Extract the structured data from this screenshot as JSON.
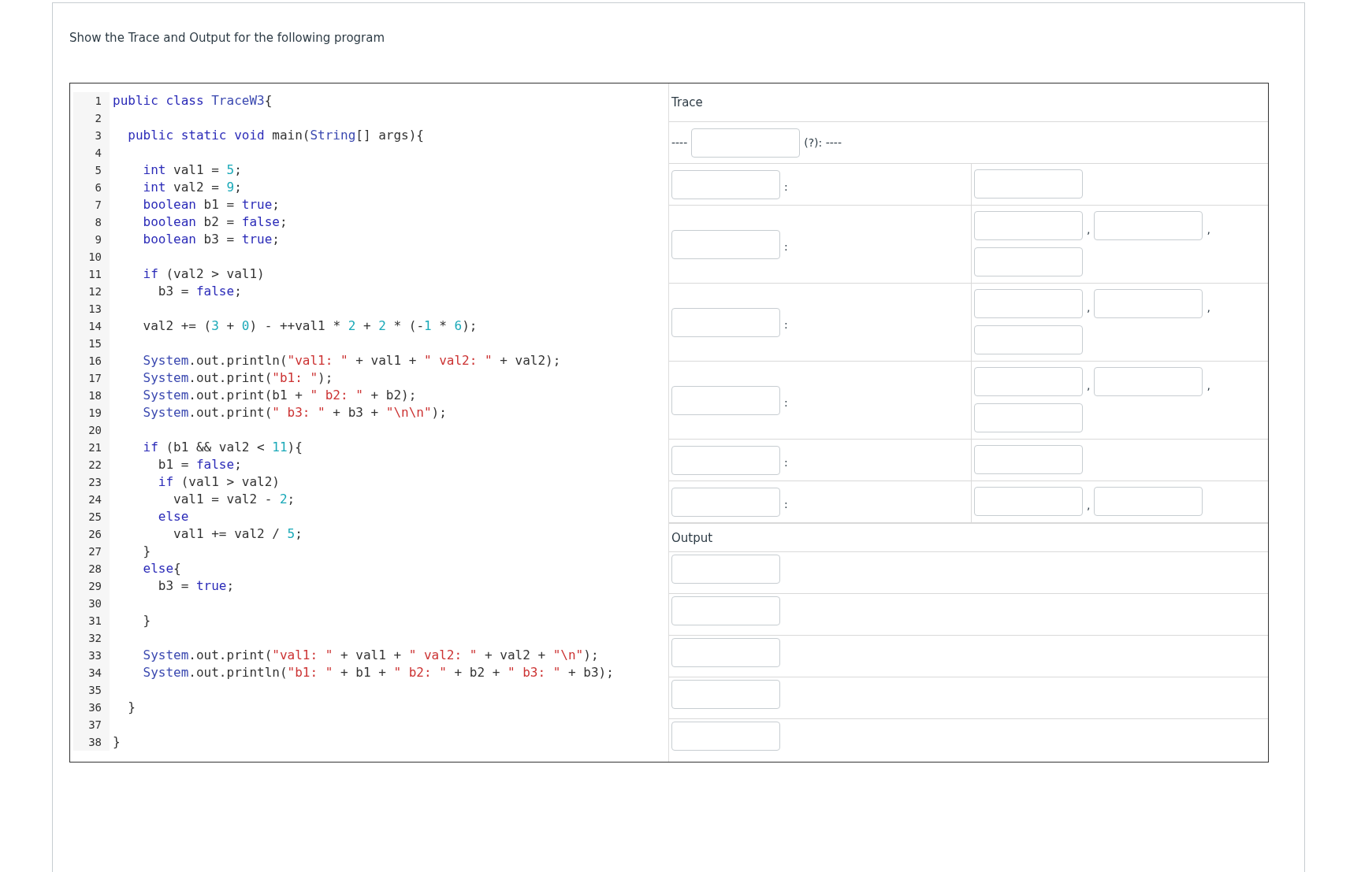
{
  "prompt": "Show the Trace and Output for the following program",
  "code": [
    {
      "n": "1",
      "tokens": [
        {
          "kind": "kw",
          "t": "public class "
        },
        {
          "kind": "type",
          "t": "TraceW3"
        },
        {
          "kind": "plain",
          "t": "{"
        }
      ]
    },
    {
      "n": "2"
    },
    {
      "n": "3",
      "tokens": [
        {
          "kind": "kw",
          "t": "  public static void "
        },
        {
          "kind": "plain",
          "t": "main("
        },
        {
          "kind": "type",
          "t": "String"
        },
        {
          "kind": "plain",
          "t": "[] args){"
        }
      ]
    },
    {
      "n": "4"
    },
    {
      "n": "5",
      "tokens": [
        {
          "kind": "kw",
          "t": "    int"
        },
        {
          "kind": "plain",
          "t": " val1 = "
        },
        {
          "kind": "num",
          "t": "5"
        },
        {
          "kind": "plain",
          "t": ";"
        }
      ]
    },
    {
      "n": "6",
      "tokens": [
        {
          "kind": "kw",
          "t": "    int"
        },
        {
          "kind": "plain",
          "t": " val2 = "
        },
        {
          "kind": "num",
          "t": "9"
        },
        {
          "kind": "plain",
          "t": ";"
        }
      ]
    },
    {
      "n": "7",
      "tokens": [
        {
          "kind": "kw",
          "t": "    boolean"
        },
        {
          "kind": "plain",
          "t": " b1 = "
        },
        {
          "kind": "kw",
          "t": "true"
        },
        {
          "kind": "plain",
          "t": ";"
        }
      ]
    },
    {
      "n": "8",
      "tokens": [
        {
          "kind": "kw",
          "t": "    boolean"
        },
        {
          "kind": "plain",
          "t": " b2 = "
        },
        {
          "kind": "kw",
          "t": "false"
        },
        {
          "kind": "plain",
          "t": ";"
        }
      ]
    },
    {
      "n": "9",
      "tokens": [
        {
          "kind": "kw",
          "t": "    boolean"
        },
        {
          "kind": "plain",
          "t": " b3 = "
        },
        {
          "kind": "kw",
          "t": "true"
        },
        {
          "kind": "plain",
          "t": ";"
        }
      ]
    },
    {
      "n": "10"
    },
    {
      "n": "11",
      "tokens": [
        {
          "kind": "kw",
          "t": "    if"
        },
        {
          "kind": "plain",
          "t": " (val2 > val1)"
        }
      ]
    },
    {
      "n": "12",
      "tokens": [
        {
          "kind": "plain",
          "t": "      b3 = "
        },
        {
          "kind": "kw",
          "t": "false"
        },
        {
          "kind": "plain",
          "t": ";"
        }
      ]
    },
    {
      "n": "13"
    },
    {
      "n": "14",
      "tokens": [
        {
          "kind": "plain",
          "t": "    val2 += ("
        },
        {
          "kind": "num",
          "t": "3"
        },
        {
          "kind": "plain",
          "t": " + "
        },
        {
          "kind": "num",
          "t": "0"
        },
        {
          "kind": "plain",
          "t": ") - ++val1 * "
        },
        {
          "kind": "num",
          "t": "2"
        },
        {
          "kind": "plain",
          "t": " + "
        },
        {
          "kind": "num",
          "t": "2"
        },
        {
          "kind": "plain",
          "t": " * (-"
        },
        {
          "kind": "num",
          "t": "1"
        },
        {
          "kind": "plain",
          "t": " * "
        },
        {
          "kind": "num",
          "t": "6"
        },
        {
          "kind": "plain",
          "t": ");"
        }
      ]
    },
    {
      "n": "15"
    },
    {
      "n": "16",
      "tokens": [
        {
          "kind": "type",
          "t": "    System"
        },
        {
          "kind": "plain",
          "t": ".out.println("
        },
        {
          "kind": "str",
          "t": "\"val1: \""
        },
        {
          "kind": "plain",
          "t": " + val1 + "
        },
        {
          "kind": "str",
          "t": "\" val2: \""
        },
        {
          "kind": "plain",
          "t": " + val2);"
        }
      ]
    },
    {
      "n": "17",
      "tokens": [
        {
          "kind": "type",
          "t": "    System"
        },
        {
          "kind": "plain",
          "t": ".out.print("
        },
        {
          "kind": "str",
          "t": "\"b1: \""
        },
        {
          "kind": "plain",
          "t": ");"
        }
      ]
    },
    {
      "n": "18",
      "tokens": [
        {
          "kind": "type",
          "t": "    System"
        },
        {
          "kind": "plain",
          "t": ".out.print(b1 + "
        },
        {
          "kind": "str",
          "t": "\" b2: \""
        },
        {
          "kind": "plain",
          "t": " + b2);"
        }
      ]
    },
    {
      "n": "19",
      "tokens": [
        {
          "kind": "type",
          "t": "    System"
        },
        {
          "kind": "plain",
          "t": ".out.print("
        },
        {
          "kind": "str",
          "t": "\" b3: \""
        },
        {
          "kind": "plain",
          "t": " + b3 + "
        },
        {
          "kind": "str",
          "t": "\"\\n\\n\""
        },
        {
          "kind": "plain",
          "t": ");"
        }
      ]
    },
    {
      "n": "20"
    },
    {
      "n": "21",
      "tokens": [
        {
          "kind": "kw",
          "t": "    if"
        },
        {
          "kind": "plain",
          "t": " (b1 && val2 < "
        },
        {
          "kind": "num",
          "t": "11"
        },
        {
          "kind": "plain",
          "t": "){"
        }
      ]
    },
    {
      "n": "22",
      "tokens": [
        {
          "kind": "plain",
          "t": "      b1 = "
        },
        {
          "kind": "kw",
          "t": "false"
        },
        {
          "kind": "plain",
          "t": ";"
        }
      ]
    },
    {
      "n": "23",
      "tokens": [
        {
          "kind": "kw",
          "t": "      if"
        },
        {
          "kind": "plain",
          "t": " (val1 > val2)"
        }
      ]
    },
    {
      "n": "24",
      "tokens": [
        {
          "kind": "plain",
          "t": "        val1 = val2 - "
        },
        {
          "kind": "num",
          "t": "2"
        },
        {
          "kind": "plain",
          "t": ";"
        }
      ]
    },
    {
      "n": "25",
      "tokens": [
        {
          "kind": "kw",
          "t": "      else"
        }
      ]
    },
    {
      "n": "26",
      "tokens": [
        {
          "kind": "plain",
          "t": "        val1 += val2 / "
        },
        {
          "kind": "num",
          "t": "5"
        },
        {
          "kind": "plain",
          "t": ";"
        }
      ]
    },
    {
      "n": "27",
      "tokens": [
        {
          "kind": "plain",
          "t": "    }"
        }
      ]
    },
    {
      "n": "28",
      "tokens": [
        {
          "kind": "kw",
          "t": "    else"
        },
        {
          "kind": "plain",
          "t": "{"
        }
      ]
    },
    {
      "n": "29",
      "tokens": [
        {
          "kind": "plain",
          "t": "      b3 = "
        },
        {
          "kind": "kw",
          "t": "true"
        },
        {
          "kind": "plain",
          "t": ";"
        }
      ]
    },
    {
      "n": "30"
    },
    {
      "n": "31",
      "tokens": [
        {
          "kind": "plain",
          "t": "    }"
        }
      ]
    },
    {
      "n": "32"
    },
    {
      "n": "33",
      "tokens": [
        {
          "kind": "type",
          "t": "    System"
        },
        {
          "kind": "plain",
          "t": ".out.print("
        },
        {
          "kind": "str",
          "t": "\"val1: \""
        },
        {
          "kind": "plain",
          "t": " + val1 + "
        },
        {
          "kind": "str",
          "t": "\" val2: \""
        },
        {
          "kind": "plain",
          "t": " + val2 + "
        },
        {
          "kind": "str",
          "t": "\"\\n\""
        },
        {
          "kind": "plain",
          "t": ");"
        }
      ]
    },
    {
      "n": "34",
      "tokens": [
        {
          "kind": "type",
          "t": "    System"
        },
        {
          "kind": "plain",
          "t": ".out.println("
        },
        {
          "kind": "str",
          "t": "\"b1: \""
        },
        {
          "kind": "plain",
          "t": " + b1 + "
        },
        {
          "kind": "str",
          "t": "\" b2: \""
        },
        {
          "kind": "plain",
          "t": " + b2 + "
        },
        {
          "kind": "str",
          "t": "\" b3: \""
        },
        {
          "kind": "plain",
          "t": " + b3);"
        }
      ]
    },
    {
      "n": "35"
    },
    {
      "n": "36",
      "tokens": [
        {
          "kind": "plain",
          "t": "  }"
        }
      ]
    },
    {
      "n": "37"
    },
    {
      "n": "38",
      "tokens": [
        {
          "kind": "plain",
          "t": "}"
        }
      ]
    }
  ],
  "trace": {
    "heading": "Trace",
    "first_row": {
      "before": "----",
      "after": "(?): ----"
    },
    "rows": [
      {
        "separator": ":",
        "right_lines": [
          [
            {
              "kind": "field"
            }
          ]
        ]
      },
      {
        "separator": ":",
        "right_lines": [
          [
            {
              "kind": "field"
            },
            {
              "kind": "text",
              "text": ","
            },
            {
              "kind": "field"
            },
            {
              "kind": "text",
              "text": ","
            }
          ],
          [
            {
              "kind": "field"
            }
          ]
        ]
      },
      {
        "separator": ":",
        "right_lines": [
          [
            {
              "kind": "field"
            },
            {
              "kind": "text",
              "text": ","
            },
            {
              "kind": "field"
            },
            {
              "kind": "text",
              "text": ","
            }
          ],
          [
            {
              "kind": "field"
            }
          ]
        ]
      },
      {
        "separator": ":",
        "right_lines": [
          [
            {
              "kind": "field"
            },
            {
              "kind": "text",
              "text": ","
            },
            {
              "kind": "field"
            },
            {
              "kind": "text",
              "text": ","
            }
          ],
          [
            {
              "kind": "field"
            }
          ]
        ]
      },
      {
        "separator": ":",
        "right_lines": [
          [
            {
              "kind": "field"
            }
          ]
        ]
      },
      {
        "separator": ":",
        "right_lines": [
          [
            {
              "kind": "field"
            },
            {
              "kind": "text",
              "text": ","
            },
            {
              "kind": "field"
            }
          ]
        ]
      }
    ]
  },
  "output": {
    "heading": "Output",
    "rows": [
      {
        "kind": "field"
      },
      {
        "kind": "field"
      },
      {
        "kind": "field"
      },
      {
        "kind": "field"
      },
      {
        "kind": "field"
      }
    ]
  }
}
